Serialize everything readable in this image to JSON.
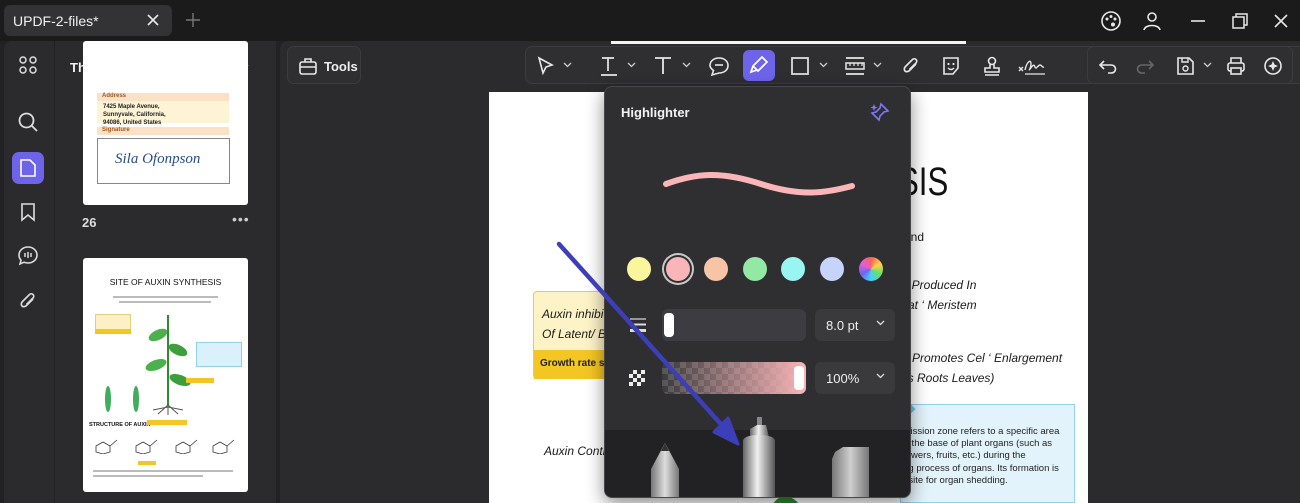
{
  "window": {
    "tab_title": "UPDF-2-files*"
  },
  "thumbnails": {
    "title": "Thumbnails",
    "drag_handle": "• • •",
    "menu_glyph": "•••",
    "pages": [
      {
        "number": "26",
        "fields": [
          {
            "label": "Address",
            "value": "7425 Maple Avenue, Sunnyvale, California, 94086, United States"
          },
          {
            "label": "Signature",
            "value": "Sila Ofonpson"
          }
        ]
      },
      {
        "number": "",
        "title": "SITE OF AUXIN SYNTHESIS",
        "subtitle": "STRUCTURE OF AUXIN"
      }
    ]
  },
  "main": {
    "tools_label": "Tools",
    "colors": {
      "accent": "#6e64ea",
      "highlight_pink": "#f9b5b7"
    }
  },
  "document": {
    "title_fragment": "SIS",
    "lines": [
      "and",
      "in Produced In",
      "cat ‘ Meristem",
      "Promotes Cel ‘ Enlargement",
      "es Roots Leaves)"
    ],
    "yellow_box": {
      "line1": "Auxin inhibit",
      "line2": "Of Latent/ B",
      "band": "Growth rate sl"
    },
    "left_caption": "Auxin Contr",
    "blue_box_lines": [
      "scission zone refers to a specific area",
      "at the base of plant organs (such as",
      "flowers, fruits, etc.) during the",
      "ing process of organs. Its formation is",
      "uisite for organ shedding."
    ]
  },
  "highlighter": {
    "title": "Highlighter",
    "colors": [
      "#fbf59e",
      "#f9b5b7",
      "#f8c4a6",
      "#93e8a4",
      "#98f5f1",
      "#c6d4fb"
    ],
    "selected_color": "#f9b5b7",
    "thickness": "8.0 pt",
    "opacity": "100%",
    "opacity_level": 1.0
  }
}
